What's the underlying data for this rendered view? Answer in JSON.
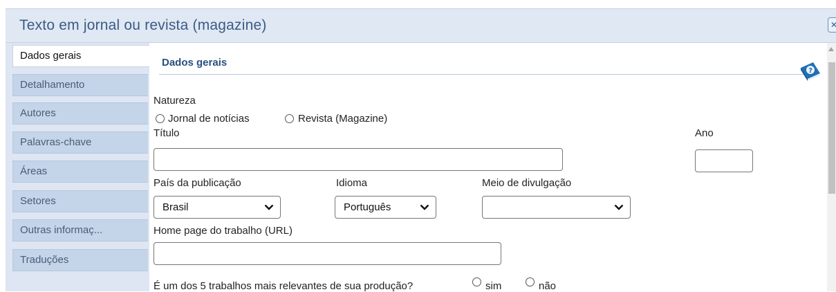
{
  "window": {
    "title": "Texto em jornal ou revista (magazine)",
    "close_icon": "close-icon"
  },
  "sidebar": {
    "items": [
      {
        "label": "Dados gerais",
        "active": true
      },
      {
        "label": "Detalhamento",
        "active": false
      },
      {
        "label": "Autores",
        "active": false
      },
      {
        "label": "Palavras-chave",
        "active": false
      },
      {
        "label": "Áreas",
        "active": false
      },
      {
        "label": "Setores",
        "active": false
      },
      {
        "label": "Outras informaç...",
        "active": false
      },
      {
        "label": "Traduções",
        "active": false
      }
    ]
  },
  "main": {
    "section_title": "Dados gerais",
    "help_icon": "help-book-icon",
    "natureza": {
      "label": "Natureza",
      "options": [
        "Jornal de notícias",
        "Revista (Magazine)"
      ]
    },
    "titulo": {
      "label": "Título",
      "value": ""
    },
    "ano": {
      "label": "Ano",
      "value": ""
    },
    "pais": {
      "label": "País da publicação",
      "value": "Brasil"
    },
    "idioma": {
      "label": "Idioma",
      "value": "Português"
    },
    "meio": {
      "label": "Meio de divulgação",
      "value": ""
    },
    "homepage": {
      "label": "Home page do trabalho (URL)",
      "value": ""
    },
    "relevantes": {
      "label": "É um dos 5 trabalhos mais relevantes de sua produção?",
      "options": [
        "sim",
        "não"
      ]
    }
  },
  "colors": {
    "title_bar": "#dfe8f3",
    "title_text": "#3b5b86",
    "sidebar_bg": "#dde6f2",
    "tab_bg": "#c4d5e9",
    "section_title": "#274f7e"
  }
}
